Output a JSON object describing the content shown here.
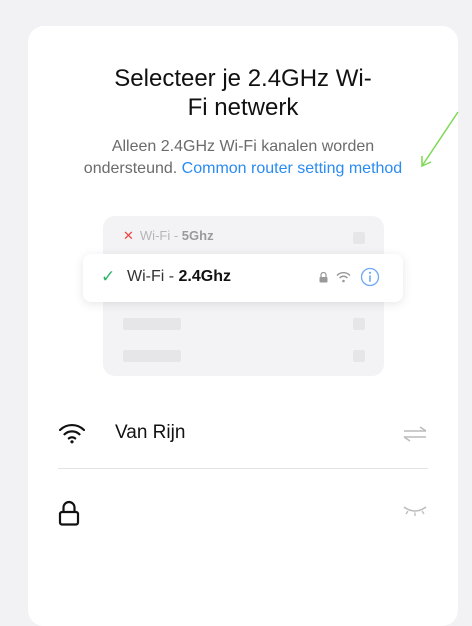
{
  "title": {
    "line1": "Selecteer je 2.4GHz Wi-",
    "line2": "Fi netwerk"
  },
  "subtitle": {
    "line1": "Alleen 2.4GHz Wi-Fi kanalen worden",
    "line2_text": "ondersteund.",
    "link": "Common router setting method"
  },
  "illustration": {
    "row_5ghz": {
      "prefix": "Wi-Fi - ",
      "band": "5Ghz",
      "status_icon": "x-icon"
    },
    "row_24ghz": {
      "prefix": "Wi-Fi - ",
      "band": "2.4Ghz",
      "status_icon": "check-icon"
    }
  },
  "network": {
    "ssid": "Van Rijn",
    "icon": "wifi-icon",
    "switch_icon": "swap-arrows-icon"
  },
  "password": {
    "value": "",
    "icon": "lock-icon",
    "toggle_icon": "eye-closed-icon"
  },
  "colors": {
    "link": "#2a8bf2",
    "success": "#2cb46c",
    "error": "#f0453e",
    "annotation_arrow": "#7ed957"
  }
}
